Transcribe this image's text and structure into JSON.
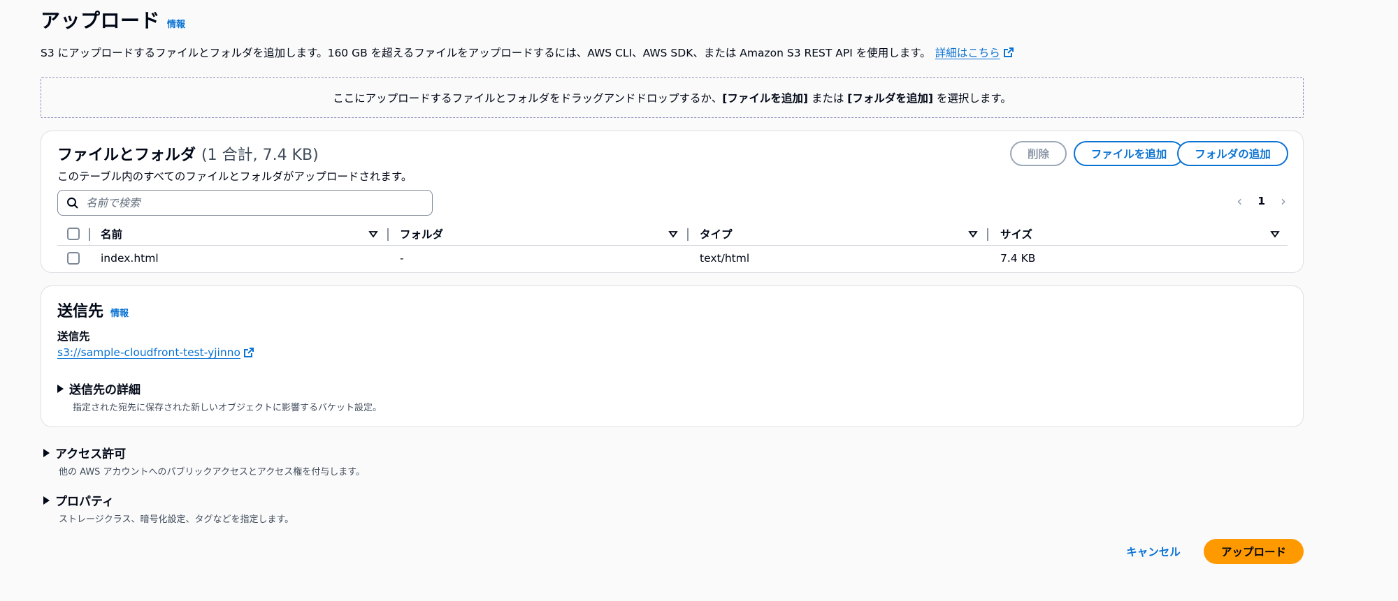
{
  "header": {
    "title": "アップロード",
    "info_link": "情報"
  },
  "description": {
    "text": "S3 にアップロードするファイルとフォルダを追加します。160 GB を超えるファイルをアップロードするには、AWS CLI、AWS SDK、または Amazon S3 REST API を使用します。",
    "link": "詳細はこちら"
  },
  "dropzone": {
    "prefix": "ここにアップロードするファイルとフォルダをドラッグアンドドロップするか、",
    "add_files": "[ファイルを追加]",
    "middle": " または ",
    "add_folder": "[フォルダを追加]",
    "suffix": " を選択します。"
  },
  "files_panel": {
    "title": "ファイルとフォルダ",
    "count": "(1 合計, 7.4 KB)",
    "subtitle": "このテーブル内のすべてのファイルとフォルダがアップロードされます。",
    "delete_label": "削除",
    "add_files_label": "ファイルを追加",
    "add_folder_label": "フォルダの追加",
    "search_placeholder": "名前で検索",
    "current_page": "1",
    "columns": [
      "名前",
      "フォルダ",
      "タイプ",
      "サイズ"
    ],
    "rows": [
      {
        "name": "index.html",
        "folder": "-",
        "type": "text/html",
        "size": "7.4 KB"
      }
    ]
  },
  "destination": {
    "title": "送信先",
    "info_link": "情報",
    "label": "送信先",
    "bucket_link": "s3://sample-cloudfront-test-yjinno",
    "details_title": "送信先の詳細",
    "details_sub": "指定された宛先に保存された新しいオブジェクトに影響するバケット設定。"
  },
  "permissions": {
    "title": "アクセス許可",
    "sub": "他の AWS アカウントへのパブリックアクセスとアクセス権を付与します。"
  },
  "properties": {
    "title": "プロパティ",
    "sub": "ストレージクラス、暗号化設定、タグなどを指定します。"
  },
  "footer": {
    "cancel_label": "キャンセル",
    "upload_label": "アップロード"
  },
  "colors": {
    "link": "#0972d3",
    "primary_button": "#ff9900",
    "text": "#000716"
  }
}
